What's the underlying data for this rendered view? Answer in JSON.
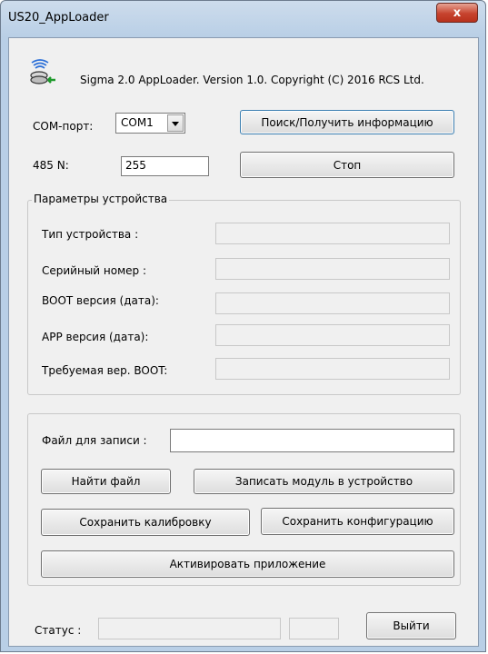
{
  "window": {
    "title": "US20_AppLoader",
    "close_glyph": "x"
  },
  "header": {
    "icon": "antenna-disk-icon",
    "text": "Sigma 2.0  AppLoader.  Version 1.0.  Copyright (C) 2016 RCS Ltd."
  },
  "com": {
    "label": "COM-порт:",
    "value": "COM1",
    "search_button": "Поиск/Получить информацию"
  },
  "addr": {
    "label": "485 N:",
    "value": "255",
    "stop_button": "Стоп"
  },
  "device_params": {
    "title": "Параметры устройства",
    "fields": [
      {
        "label": "Тип устройства :",
        "value": ""
      },
      {
        "label": "Серийный номер :",
        "value": ""
      },
      {
        "label": "BOOT версия (дата):",
        "value": ""
      },
      {
        "label": "APP версия (дата):",
        "value": ""
      },
      {
        "label": "Требуемая вер. BOOT:",
        "value": ""
      }
    ]
  },
  "file": {
    "label": "Файл для записи :",
    "value": "",
    "find_button": "Найти файл",
    "write_button": "Записать модуль в устройство",
    "save_calib_button": "Сохранить калибровку",
    "save_config_button": "Сохранить конфигурацию",
    "activate_button": "Активировать приложение"
  },
  "status": {
    "label": "Статус :",
    "value": "",
    "extra": "",
    "exit_button": "Выйти"
  },
  "colors": {
    "title_gradient": "#cddcec",
    "close": "#c7432e",
    "client_bg": "#f0f0f0"
  }
}
